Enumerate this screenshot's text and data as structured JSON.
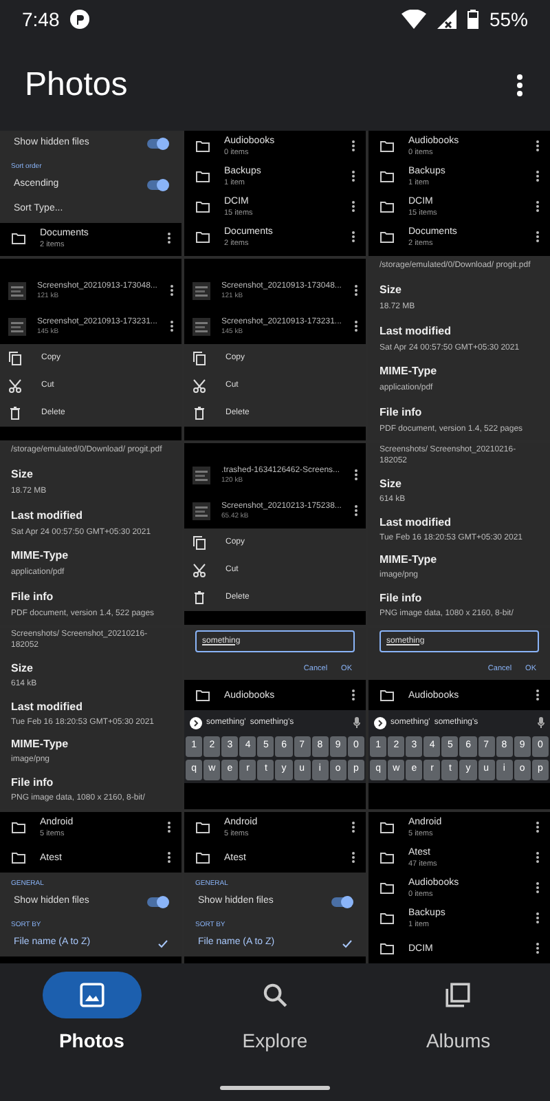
{
  "status_bar": {
    "time": "7:48",
    "battery": "55%"
  },
  "app_bar": {
    "title": "Photos"
  },
  "grid": {
    "tiles": [
      {
        "blocks": [
          {
            "kind": "toggle",
            "label": "Show hidden files",
            "on": true
          },
          {
            "kind": "section",
            "label": "Sort order"
          },
          {
            "kind": "toggle",
            "label": "Ascending",
            "on": true
          },
          {
            "kind": "option",
            "label": "Sort Type...",
            "checked": false
          },
          {
            "kind": "folder",
            "name": "Documents",
            "count": "2 items"
          }
        ]
      },
      {
        "blocks": [
          {
            "kind": "folder",
            "name": "Audiobooks",
            "count": "0 items"
          },
          {
            "kind": "folder",
            "name": "Backups",
            "count": "1 item"
          },
          {
            "kind": "folder",
            "name": "DCIM",
            "count": "15 items"
          },
          {
            "kind": "folder",
            "name": "Documents",
            "count": "2 items"
          }
        ]
      },
      {
        "blocks": [
          {
            "kind": "folder",
            "name": "Audiobooks",
            "count": "0 items"
          },
          {
            "kind": "folder",
            "name": "Backups",
            "count": "1 item"
          },
          {
            "kind": "folder",
            "name": "DCIM",
            "count": "15 items"
          },
          {
            "kind": "folder",
            "name": "Documents",
            "count": "2 items"
          }
        ]
      },
      {
        "blocks": [
          {
            "kind": "gap"
          },
          {
            "kind": "file",
            "name": "Screenshot_20210913-173048...",
            "size": "121 kB"
          },
          {
            "kind": "file",
            "name": "Screenshot_20210913-173231...",
            "size": "145 kB"
          },
          {
            "kind": "copy",
            "label": "Copy"
          },
          {
            "kind": "cut",
            "label": "Cut"
          },
          {
            "kind": "delete",
            "label": "Delete"
          }
        ]
      },
      {
        "blocks": [
          {
            "kind": "gap"
          },
          {
            "kind": "file",
            "name": "Screenshot_20210913-173048...",
            "size": "121 kB"
          },
          {
            "kind": "file",
            "name": "Screenshot_20210913-173231...",
            "size": "145 kB"
          },
          {
            "kind": "copy",
            "label": "Copy"
          },
          {
            "kind": "cut",
            "label": "Cut"
          },
          {
            "kind": "delete",
            "label": "Delete"
          }
        ]
      },
      {
        "blocks": [
          {
            "kind": "info_text",
            "text": "/storage/emulated/0/Download/ progit.pdf"
          },
          {
            "kind": "info_title",
            "text": "Size"
          },
          {
            "kind": "info_text",
            "text": "18.72 MB"
          },
          {
            "kind": "info_title",
            "text": "Last modified"
          },
          {
            "kind": "info_text",
            "text": "Sat Apr 24 00:57:50 GMT+05:30 2021"
          },
          {
            "kind": "info_title",
            "text": "MIME-Type"
          },
          {
            "kind": "info_text",
            "text": "application/pdf"
          },
          {
            "kind": "info_title",
            "text": "File info"
          },
          {
            "kind": "info_text",
            "text": "PDF document, version 1.4, 522 pages"
          }
        ]
      },
      {
        "blocks": [
          {
            "kind": "info_text",
            "text": "/storage/emulated/0/Download/ progit.pdf"
          },
          {
            "kind": "info_title",
            "text": "Size"
          },
          {
            "kind": "info_text",
            "text": "18.72 MB"
          },
          {
            "kind": "info_title",
            "text": "Last modified"
          },
          {
            "kind": "info_text",
            "text": "Sat Apr 24 00:57:50 GMT+05:30 2021"
          },
          {
            "kind": "info_title",
            "text": "MIME-Type"
          },
          {
            "kind": "info_text",
            "text": "application/pdf"
          },
          {
            "kind": "info_title",
            "text": "File info"
          },
          {
            "kind": "info_text",
            "text": "PDF document, version 1.4, 522 pages"
          }
        ]
      },
      {
        "blocks": [
          {
            "kind": "gap"
          },
          {
            "kind": "file",
            "name": ".trashed-1634126462-Screens...",
            "size": "120 kB"
          },
          {
            "kind": "file",
            "name": "Screenshot_20210213-175238...",
            "size": "65.42 kB"
          },
          {
            "kind": "copy",
            "label": "Copy"
          },
          {
            "kind": "cut",
            "label": "Cut"
          },
          {
            "kind": "delete",
            "label": "Delete"
          }
        ]
      },
      {
        "blocks": [
          {
            "kind": "info_text",
            "text": "Screenshots/ Screenshot_20210216-182052"
          },
          {
            "kind": "info_title",
            "text": "Size"
          },
          {
            "kind": "info_text",
            "text": "614 kB"
          },
          {
            "kind": "info_title",
            "text": "Last modified"
          },
          {
            "kind": "info_text",
            "text": "Tue Feb 16 18:20:53 GMT+05:30 2021"
          },
          {
            "kind": "info_title",
            "text": "MIME-Type"
          },
          {
            "kind": "info_text",
            "text": "image/png"
          },
          {
            "kind": "info_title",
            "text": "File info"
          },
          {
            "kind": "info_text",
            "text": "PNG image data, 1080 x 2160, 8-bit/"
          }
        ]
      },
      {
        "blocks": [
          {
            "kind": "info_text",
            "text": "Screenshots/ Screenshot_20210216-182052"
          },
          {
            "kind": "info_title",
            "text": "Size"
          },
          {
            "kind": "info_text",
            "text": "614 kB"
          },
          {
            "kind": "info_title",
            "text": "Last modified"
          },
          {
            "kind": "info_text",
            "text": "Tue Feb 16 18:20:53 GMT+05:30 2021"
          },
          {
            "kind": "info_title",
            "text": "MIME-Type"
          },
          {
            "kind": "info_text",
            "text": "image/png"
          },
          {
            "kind": "info_title",
            "text": "File info"
          },
          {
            "kind": "info_text",
            "text": "PNG image data, 1080 x 2160, 8-bit/"
          }
        ]
      },
      {
        "blocks": [
          {
            "kind": "field",
            "value": "something"
          },
          {
            "kind": "dialog_buttons",
            "buttons": [
              "Cancel",
              "OK"
            ]
          },
          {
            "kind": "folder",
            "name": "Audiobooks"
          },
          {
            "kind": "suggestions",
            "words": [
              "something'",
              "something's"
            ]
          },
          {
            "kind": "keyboard",
            "rows": [
              [
                "1",
                "2",
                "3",
                "4",
                "5",
                "6",
                "7",
                "8",
                "9",
                "0"
              ],
              [
                "q",
                "w",
                "e",
                "r",
                "t",
                "y",
                "u",
                "i",
                "o",
                "p"
              ]
            ]
          }
        ]
      },
      {
        "blocks": [
          {
            "kind": "field",
            "value": "something"
          },
          {
            "kind": "dialog_buttons",
            "buttons": [
              "Cancel",
              "OK"
            ]
          },
          {
            "kind": "folder",
            "name": "Audiobooks"
          },
          {
            "kind": "suggestions",
            "words": [
              "something'",
              "something's"
            ]
          },
          {
            "kind": "keyboard",
            "rows": [
              [
                "1",
                "2",
                "3",
                "4",
                "5",
                "6",
                "7",
                "8",
                "9",
                "0"
              ],
              [
                "q",
                "w",
                "e",
                "r",
                "t",
                "y",
                "u",
                "i",
                "o",
                "p"
              ]
            ]
          }
        ]
      },
      {
        "blocks": [
          {
            "kind": "folder",
            "name": "Android",
            "count": "5 items"
          },
          {
            "kind": "folder",
            "name": "Atest"
          },
          {
            "kind": "section",
            "label": "GENERAL"
          },
          {
            "kind": "toggle",
            "label": "Show hidden files",
            "on": true
          },
          {
            "kind": "section",
            "label": "SORT BY"
          },
          {
            "kind": "option",
            "label": "File name (A to Z)",
            "checked": true
          }
        ]
      },
      {
        "blocks": [
          {
            "kind": "folder",
            "name": "Android",
            "count": "5 items"
          },
          {
            "kind": "folder",
            "name": "Atest"
          },
          {
            "kind": "section",
            "label": "GENERAL"
          },
          {
            "kind": "toggle",
            "label": "Show hidden files",
            "on": true
          },
          {
            "kind": "section",
            "label": "SORT BY"
          },
          {
            "kind": "option",
            "label": "File name (A to Z)",
            "checked": true
          }
        ]
      },
      {
        "blocks": [
          {
            "kind": "folder",
            "name": "Android",
            "count": "5 items"
          },
          {
            "kind": "folder",
            "name": "Atest",
            "count": "47 items"
          },
          {
            "kind": "folder",
            "name": "Audiobooks",
            "count": "0 items"
          },
          {
            "kind": "folder",
            "name": "Backups",
            "count": "1 item"
          },
          {
            "kind": "folder",
            "name": "DCIM"
          }
        ]
      }
    ]
  },
  "bottom_nav": [
    {
      "label": "Photos",
      "selected": true
    },
    {
      "label": "Explore",
      "selected": false
    },
    {
      "label": "Albums",
      "selected": false
    }
  ]
}
